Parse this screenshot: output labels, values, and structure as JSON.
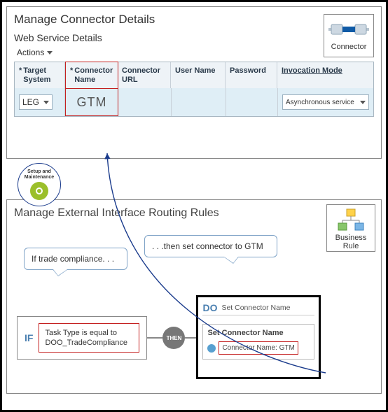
{
  "top": {
    "title": "Manage Connector Details",
    "subtitle": "Web Service Details",
    "connector_box_label": "Connector",
    "actions": "Actions"
  },
  "table": {
    "headers": {
      "target_system": "Target System",
      "connector_name": "Connector Name",
      "connector_url": "Connector URL",
      "user_name": "User Name",
      "password": "Password",
      "invocation_mode": "Invocation Mode"
    },
    "required": {
      "target_system": "*",
      "connector_name": "*"
    },
    "row": {
      "target_system": "LEG",
      "connector_name": "GTM",
      "invocation_mode": "Asynchronous service"
    }
  },
  "setup": {
    "label": "Setup and Maintenance"
  },
  "bottom": {
    "title": "Manage External Interface Routing Rules",
    "br_label": "Business Rule",
    "callout1": "If trade compliance. . .",
    "callout2": ". . .then set connector to GTM",
    "if_label": "IF",
    "condition": "Task Type is equal to DOO_TradeCompliance",
    "then_label": "THEN",
    "do_label": "DO",
    "do_sub": "Set Connector Name",
    "set_title": "Set Connector Name",
    "conn_name": "Connector Name: GTM"
  }
}
